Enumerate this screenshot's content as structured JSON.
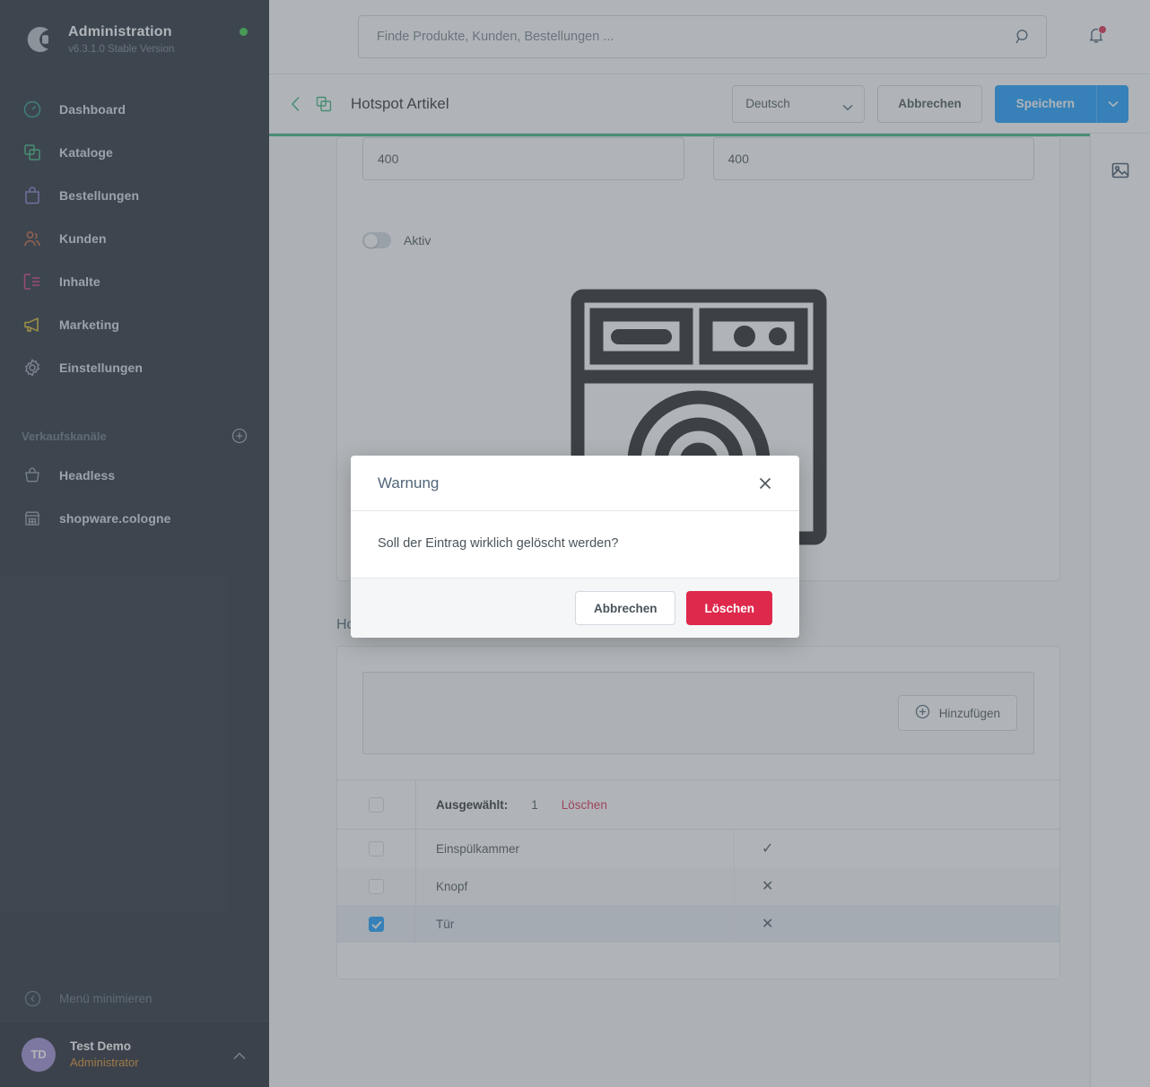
{
  "sidebar": {
    "brand": {
      "title": "Administration",
      "version": "v6.3.1.0 Stable Version",
      "status_color": "#37d046"
    },
    "items": [
      {
        "label": "Dashboard",
        "icon": "dashboard-icon",
        "color": "#2b9c8f"
      },
      {
        "label": "Kataloge",
        "icon": "catalog-icon",
        "color": "#3ab57a"
      },
      {
        "label": "Bestellungen",
        "icon": "orders-icon",
        "color": "#8b7cd0"
      },
      {
        "label": "Kunden",
        "icon": "customers-icon",
        "color": "#d2603c"
      },
      {
        "label": "Inhalte",
        "icon": "content-icon",
        "color": "#d6357f"
      },
      {
        "label": "Marketing",
        "icon": "marketing-icon",
        "color": "#e0c024"
      },
      {
        "label": "Einstellungen",
        "icon": "settings-gear-icon",
        "color": "#9aa4ae"
      }
    ],
    "sales_channels_label": "Verkaufskanäle",
    "sales_channels": [
      {
        "label": "Headless",
        "icon": "basket-icon"
      },
      {
        "label": "shopware.cologne",
        "icon": "storefront-icon"
      }
    ],
    "minimize_label": "Menü minimieren",
    "user": {
      "initials": "TD",
      "name": "Test Demo",
      "role": "Administrator"
    }
  },
  "topbar": {
    "search": {
      "placeholder": "Finde Produkte, Kunden, Bestellungen ...",
      "value": ""
    },
    "notifications_icon": "bell-icon",
    "has_notification": true
  },
  "smartbar": {
    "back_icon": "chevron-left-icon",
    "module_icon": "content-module-icon",
    "title": "Hotspot Artikel",
    "language": {
      "value": "Deutsch"
    },
    "cancel_label": "Abbrechen",
    "save_label": "Speichern"
  },
  "progress": {
    "percent": 100,
    "color": "#3bb57f"
  },
  "detail": {
    "field_left": {
      "value": "400"
    },
    "field_right": {
      "value": "400"
    },
    "active_toggle": {
      "label": "Aktiv",
      "checked": false
    },
    "media_icon": "washing-machine-illustration"
  },
  "hotspots": {
    "section_title": "Hotspots",
    "add_label": "Hinzufügen",
    "bulk": {
      "selected_label": "Ausgewählt:",
      "count": "1",
      "delete_label": "Löschen"
    },
    "rows": [
      {
        "name": "Einspülkammer",
        "flag": "✓",
        "selected": false,
        "alt": false
      },
      {
        "name": "Knopf",
        "flag": "✕",
        "selected": false,
        "alt": true
      },
      {
        "name": "Tür",
        "flag": "✕",
        "selected": true,
        "alt": false
      }
    ]
  },
  "rail": {
    "media_icon": "image-icon"
  },
  "modal": {
    "title": "Warnung",
    "close_icon": "close-icon",
    "message": "Soll der Eintrag wirklich gelöscht werden?",
    "cancel_label": "Abbrechen",
    "confirm_label": "Löschen",
    "confirm_color": "#de294c"
  }
}
